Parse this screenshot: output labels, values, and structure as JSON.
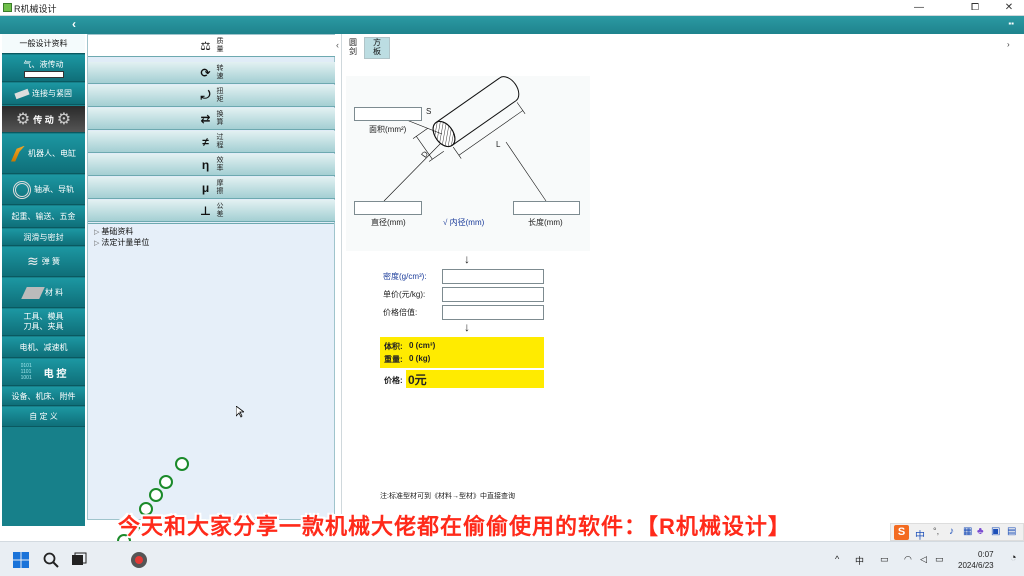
{
  "window": {
    "title": "R机械设计",
    "min_label": "—",
    "max_label": "⧠",
    "close_label": "✕"
  },
  "toolbar": {
    "collapse_label": "‹",
    "menu_label": "▪▪"
  },
  "leftnav": {
    "items": [
      {
        "label": "一般设计资料",
        "icon": "document-icon",
        "active": true
      },
      {
        "label": "气、液传动",
        "icon": "cylinder-icon"
      },
      {
        "label": "连接与紧固",
        "icon": "bolt-icon"
      },
      {
        "label": "传 动",
        "icon": "gear-icon"
      },
      {
        "label": "机器人、电缸",
        "icon": "robot-arm-icon"
      },
      {
        "label": "轴承、导轨",
        "icon": "bearing-icon"
      },
      {
        "label": "起重、输送、五金",
        "icon": ""
      },
      {
        "label": "润滑与密封",
        "icon": ""
      },
      {
        "label": "弹 簧",
        "icon": "spring-icon"
      },
      {
        "label": "材 料",
        "icon": "ibeam-icon"
      },
      {
        "label": "工具、模具\n刀具、夹具",
        "icon": ""
      },
      {
        "label": "电机、减速机",
        "icon": ""
      },
      {
        "label": "电 控",
        "icon": "binary-icon"
      },
      {
        "label": "设备、机床、附件",
        "icon": ""
      },
      {
        "label": "自 定 义",
        "icon": ""
      }
    ]
  },
  "accordion": [
    {
      "glyph": "⚖",
      "label": "质量",
      "icon": "scale-icon"
    },
    {
      "glyph": "⟳",
      "label": "转速",
      "icon": "speed-icon"
    },
    {
      "glyph": "⤾",
      "label": "扭矩",
      "icon": "torque-icon"
    },
    {
      "glyph": "⇄",
      "label": "换算",
      "icon": "convert-icon"
    },
    {
      "glyph": "≠",
      "label": "过程",
      "icon": "process-icon"
    },
    {
      "glyph": "η",
      "label": "效率",
      "icon": "efficiency-icon"
    },
    {
      "glyph": "μ",
      "label": "摩擦",
      "icon": "friction-icon"
    },
    {
      "glyph": "⊥",
      "label": "公差",
      "icon": "tolerance-icon"
    }
  ],
  "tree": [
    {
      "label": "基础资料"
    },
    {
      "label": "法定计量单位"
    }
  ],
  "tabs": [
    {
      "label": "圆剑",
      "active": true
    },
    {
      "label": "方板",
      "active": false
    }
  ],
  "diagram": {
    "area_label": "面积(mm²)",
    "s_label": "S",
    "d_label": "D",
    "l_label": "L",
    "diameter_label": "直径(mm)",
    "inner_label": "√ 内径(mm)",
    "length_label": "长度(mm)"
  },
  "form": {
    "arrow": "↓",
    "density_label": "密度(g/cm³):",
    "unit_price_label": "单价(元/kg):",
    "price_factor_label": "价格倍值:",
    "volume_label": "体积:",
    "volume_value": "0 (cm³)",
    "weight_label": "重量:",
    "weight_value": "0 (kg)",
    "price_label": "价格:",
    "price_value": "0元",
    "note": "注:标准型材可到《材料→型材》中直接查询"
  },
  "subtitle": "今天和大家分享一款机械大佬都在偷偷使用的软件：【R机械设计】",
  "taskbar": {
    "time": "0:07",
    "date": "2024/6/23",
    "ime_label": "中",
    "tray_chevron": "^",
    "ime_bar_label": "中",
    "ime_logo": "S"
  }
}
